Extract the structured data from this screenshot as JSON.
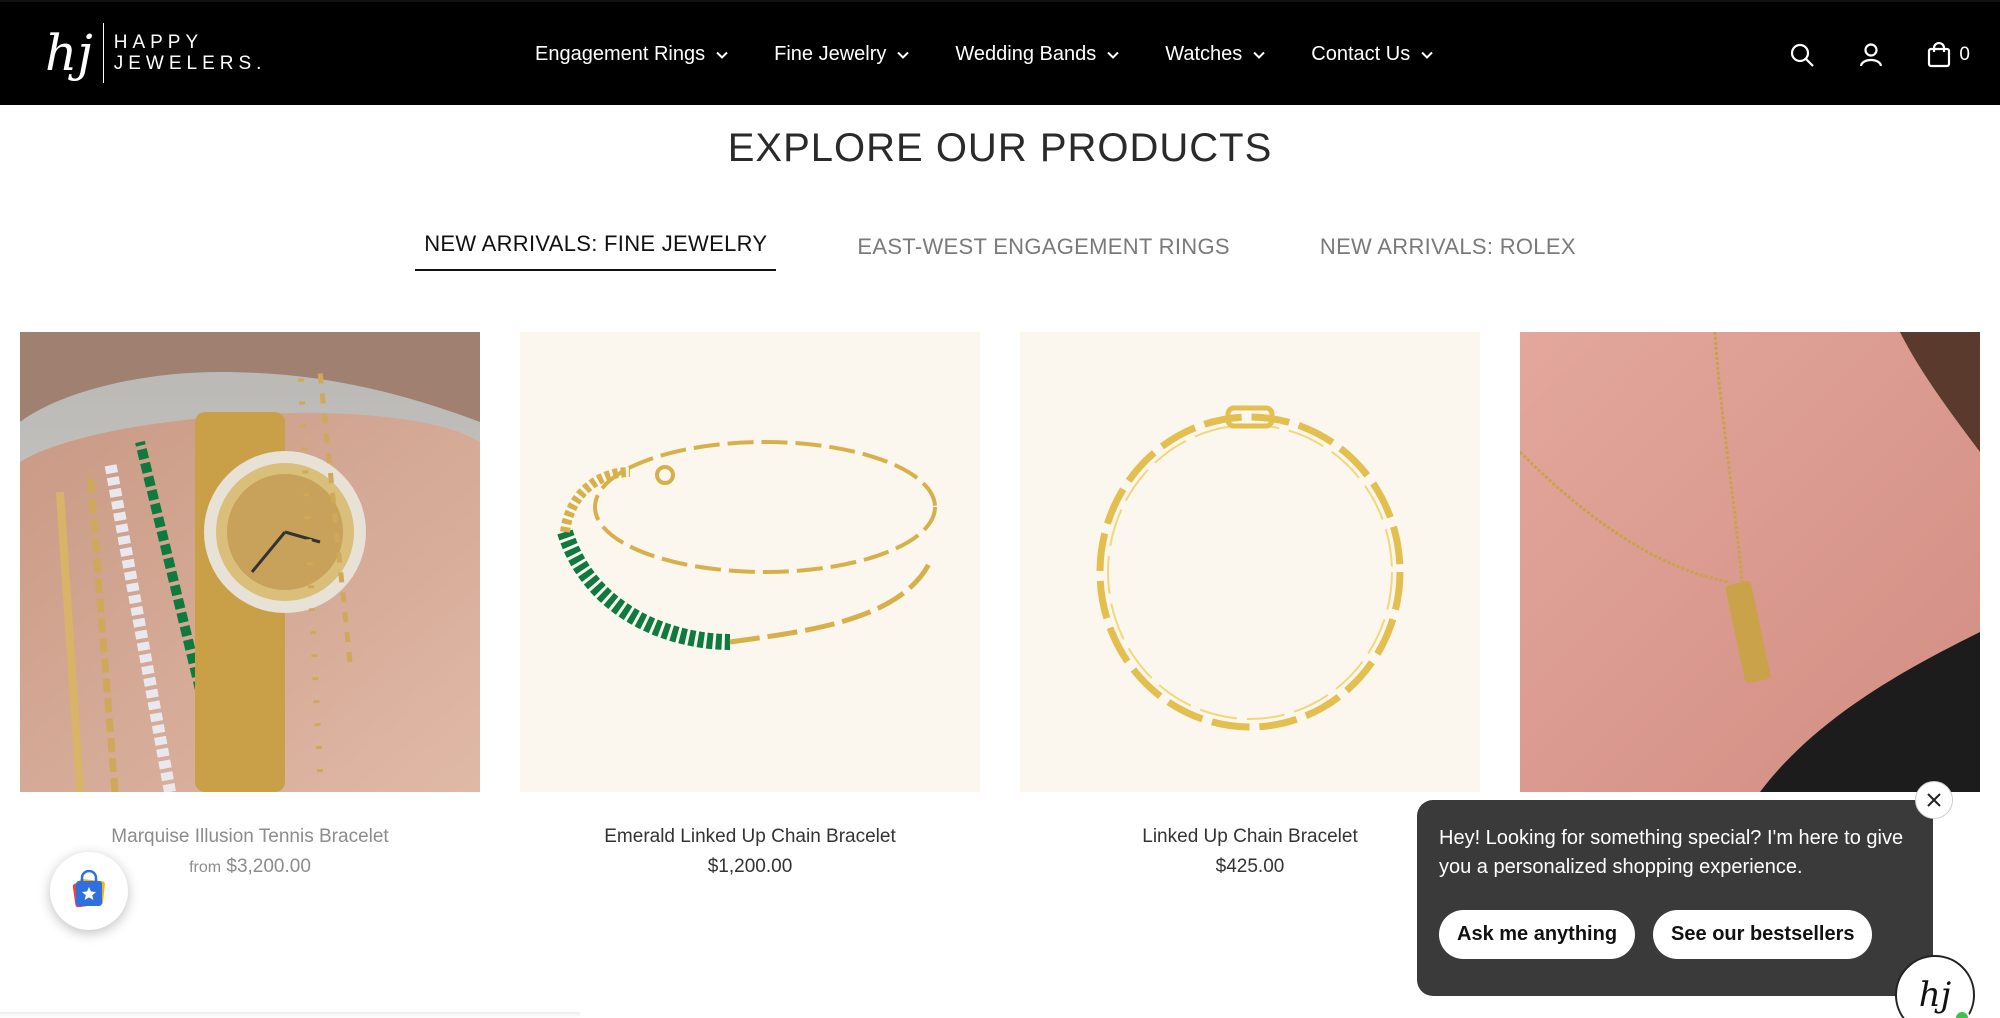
{
  "brand": {
    "mark": "hj",
    "line1": "HAPPY",
    "line2": "JEWELERS."
  },
  "nav": {
    "items": [
      {
        "label": "Engagement Rings"
      },
      {
        "label": "Fine Jewelry"
      },
      {
        "label": "Wedding Bands"
      },
      {
        "label": "Watches"
      },
      {
        "label": "Contact Us"
      }
    ]
  },
  "header_icons": {
    "search": "search-icon",
    "account": "user-icon",
    "cart": "cart-icon",
    "cart_count": "0"
  },
  "section": {
    "title": "EXPLORE OUR PRODUCTS",
    "tabs": [
      {
        "label": "NEW ARRIVALS: FINE JEWELRY",
        "active": true
      },
      {
        "label": "EAST-WEST ENGAGEMENT RINGS",
        "active": false
      },
      {
        "label": "NEW ARRIVALS: ROLEX",
        "active": false
      }
    ]
  },
  "products": [
    {
      "name": "Marquise Illusion Tennis Bracelet",
      "price_prefix": "from",
      "price": "$3,200.00"
    },
    {
      "name": "Emerald Linked Up Chain Bracelet",
      "price": "$1,200.00"
    },
    {
      "name": "Linked Up Chain Bracelet",
      "price": "$425.00"
    },
    {
      "name": "",
      "price": ""
    }
  ],
  "chat": {
    "message": "Hey! Looking for something special? I'm here to give you a personalized shopping experience.",
    "actions": [
      "Ask me anything",
      "See our bestsellers"
    ],
    "avatar_mark": "hj"
  },
  "colors": {
    "header_bg": "#000000",
    "chat_bg": "#3a3a3a",
    "gold": "#d8b04a",
    "emerald": "#0f7a3d",
    "cream": "#fbf7ef"
  }
}
